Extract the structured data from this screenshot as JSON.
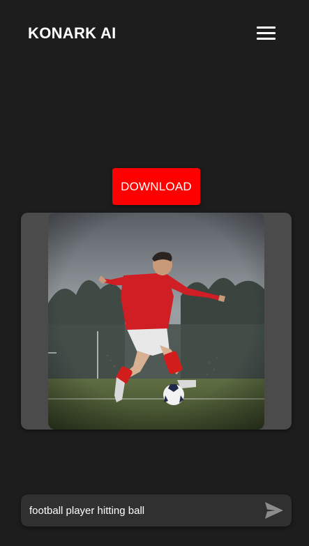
{
  "app": {
    "title": "KONARK AI"
  },
  "header": {
    "menu_icon": "hamburger-menu-icon"
  },
  "actions": {
    "download_label": "DOWNLOAD"
  },
  "result": {
    "image_subject": "football-player-kicking-ball"
  },
  "prompt": {
    "value": "football player hitting ball",
    "send_icon": "send-arrow-icon"
  },
  "colors": {
    "background": "#1d1d1d",
    "accent": "#ff0000",
    "frame": "#4b4b4b",
    "input_bg": "#303030",
    "send_icon": "#8c8c8c"
  }
}
